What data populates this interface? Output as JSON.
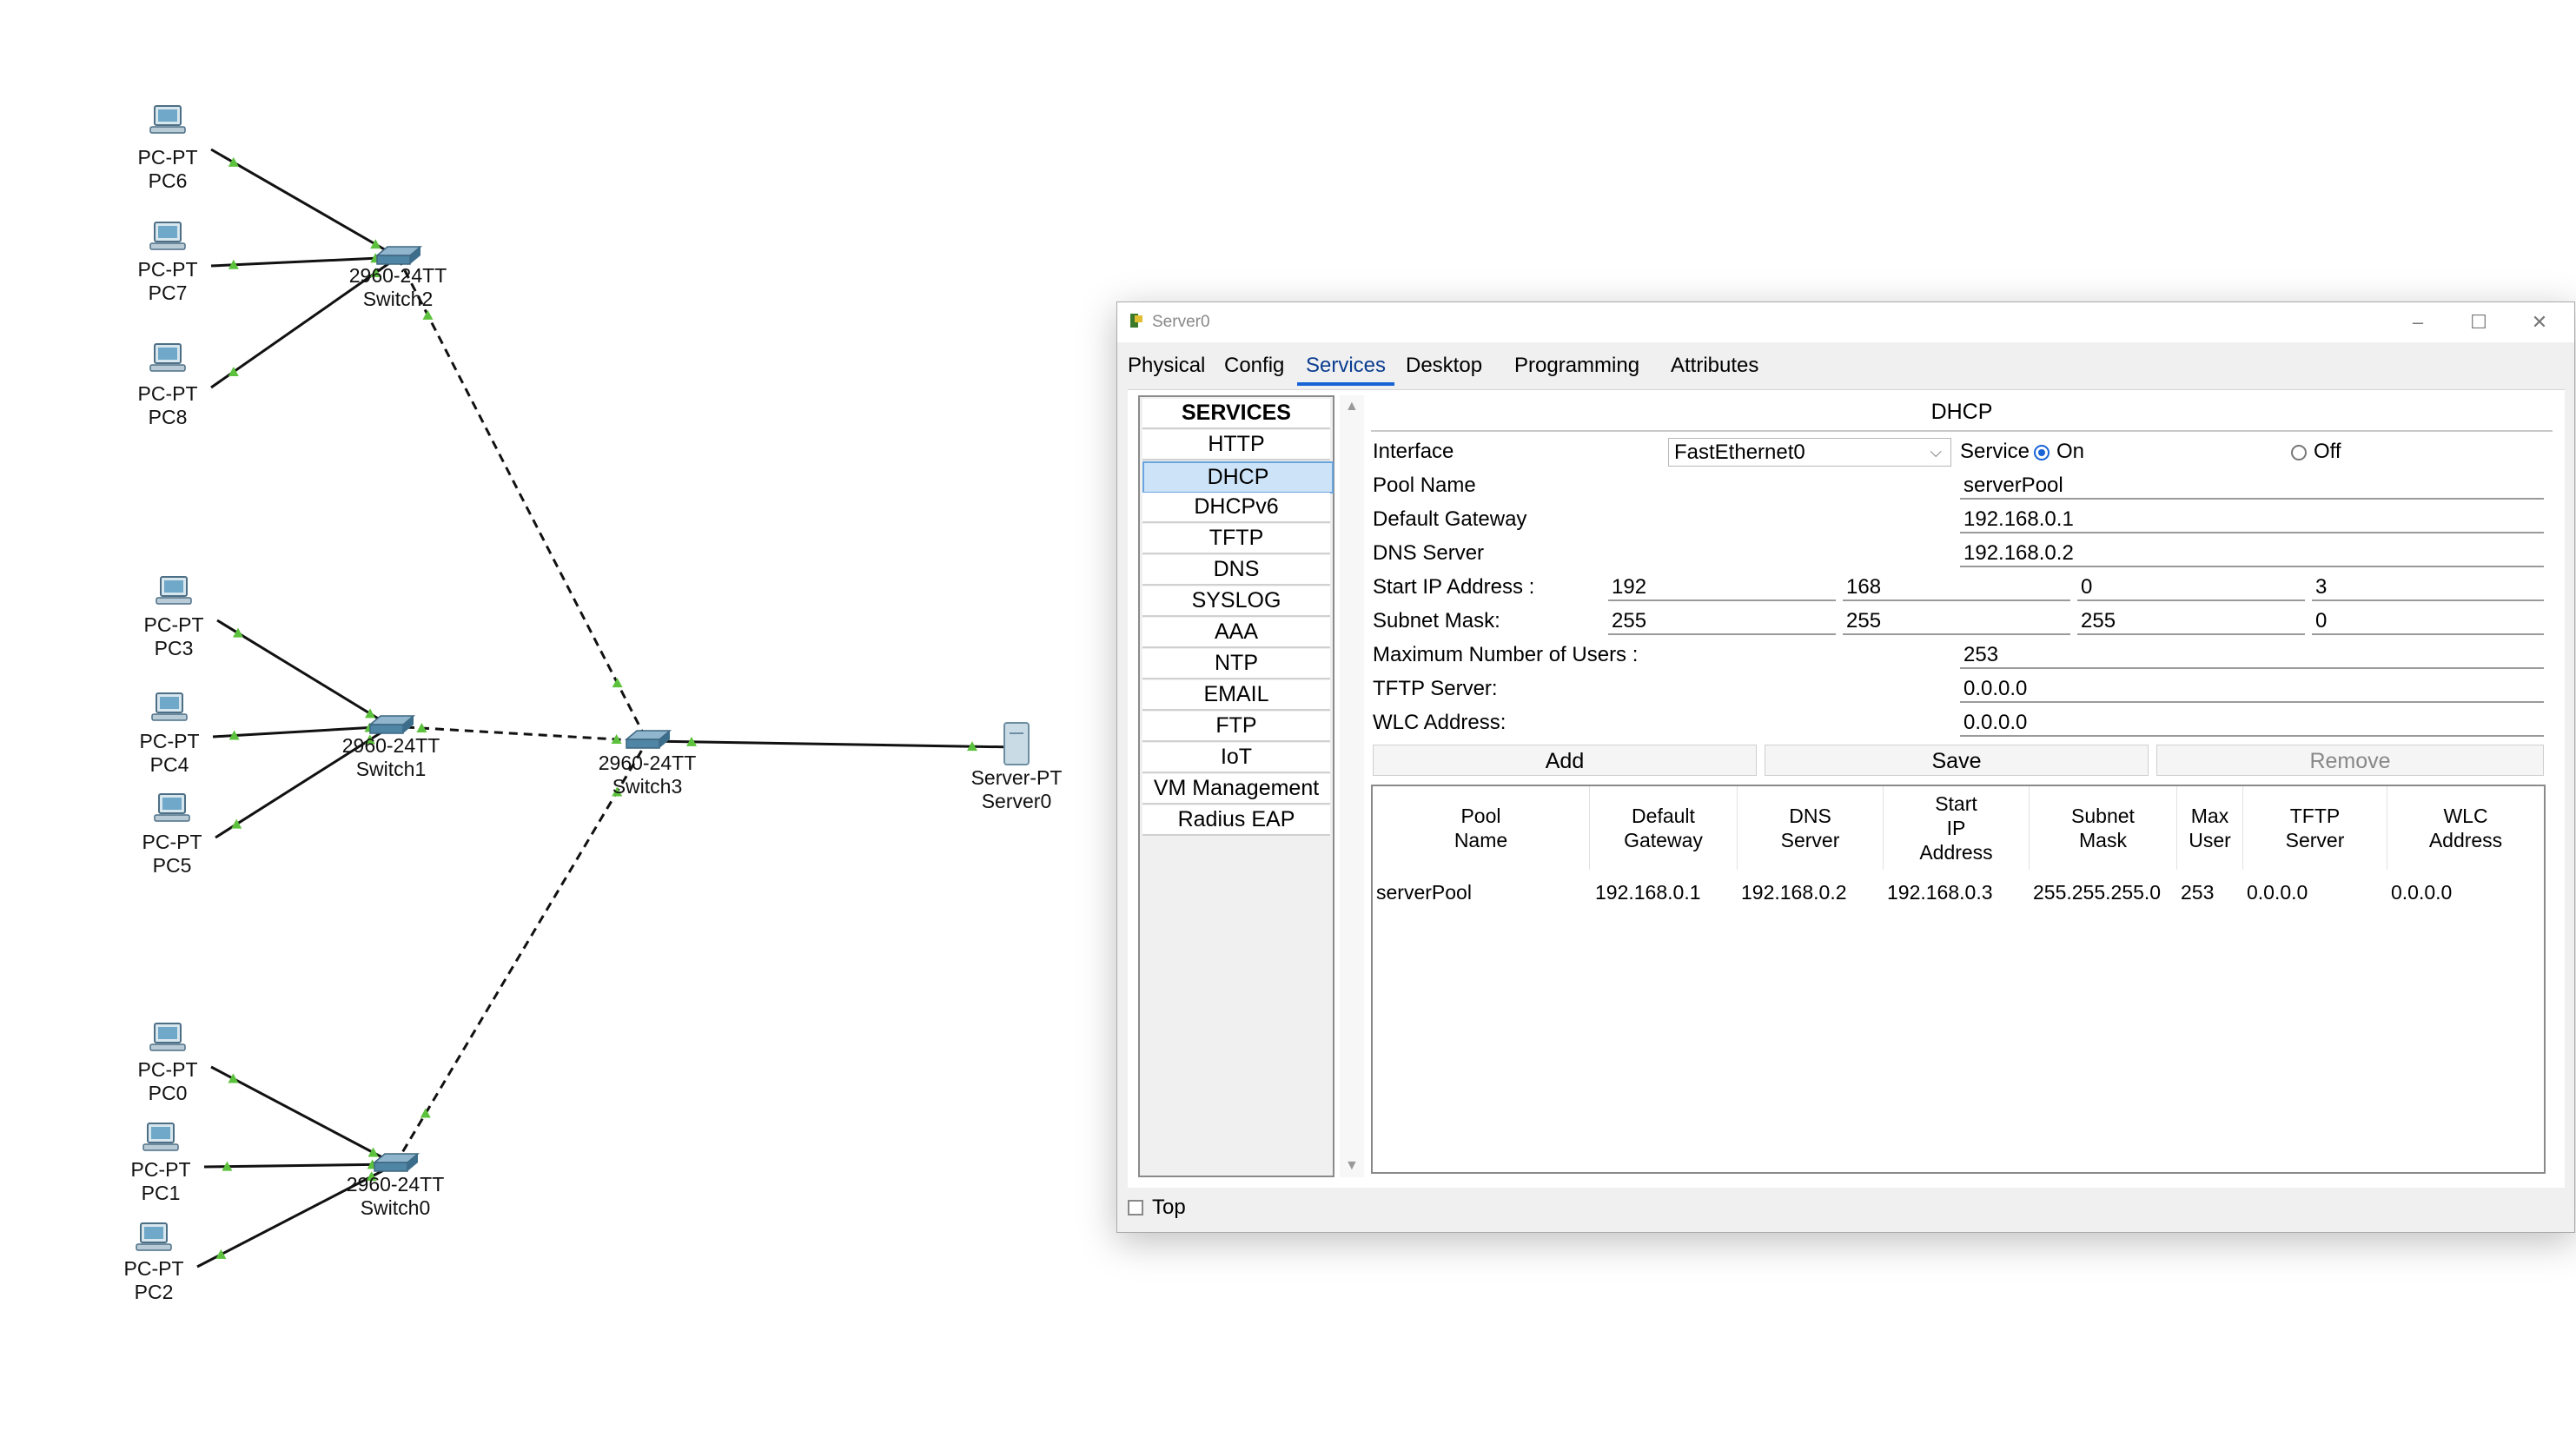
{
  "topology": {
    "devices": [
      {
        "id": "pc6",
        "model": "PC-PT",
        "name": "PC6"
      },
      {
        "id": "pc7",
        "model": "PC-PT",
        "name": "PC7"
      },
      {
        "id": "pc8",
        "model": "PC-PT",
        "name": "PC8"
      },
      {
        "id": "pc3",
        "model": "PC-PT",
        "name": "PC3"
      },
      {
        "id": "pc4",
        "model": "PC-PT",
        "name": "PC4"
      },
      {
        "id": "pc5",
        "model": "PC-PT",
        "name": "PC5"
      },
      {
        "id": "pc0",
        "model": "PC-PT",
        "name": "PC0"
      },
      {
        "id": "pc1",
        "model": "PC-PT",
        "name": "PC1"
      },
      {
        "id": "pc2",
        "model": "PC-PT",
        "name": "PC2"
      },
      {
        "id": "switch2",
        "model": "2960-24TT",
        "name": "Switch2"
      },
      {
        "id": "switch1",
        "model": "2960-24TT",
        "name": "Switch1"
      },
      {
        "id": "switch0",
        "model": "2960-24TT",
        "name": "Switch0"
      },
      {
        "id": "switch3",
        "model": "2960-24TT",
        "name": "Switch3"
      },
      {
        "id": "server0",
        "model": "Server-PT",
        "name": "Server0"
      }
    ],
    "links": [
      {
        "from": "pc6",
        "to": "switch2",
        "type": "straight"
      },
      {
        "from": "pc7",
        "to": "switch2",
        "type": "straight"
      },
      {
        "from": "pc8",
        "to": "switch2",
        "type": "straight"
      },
      {
        "from": "pc3",
        "to": "switch1",
        "type": "straight"
      },
      {
        "from": "pc4",
        "to": "switch1",
        "type": "straight"
      },
      {
        "from": "pc5",
        "to": "switch1",
        "type": "straight"
      },
      {
        "from": "pc0",
        "to": "switch0",
        "type": "straight"
      },
      {
        "from": "pc1",
        "to": "switch0",
        "type": "straight"
      },
      {
        "from": "pc2",
        "to": "switch0",
        "type": "straight"
      },
      {
        "from": "switch2",
        "to": "switch3",
        "type": "crossover"
      },
      {
        "from": "switch1",
        "to": "switch3",
        "type": "crossover"
      },
      {
        "from": "switch0",
        "to": "switch3",
        "type": "crossover"
      },
      {
        "from": "switch3",
        "to": "server0",
        "type": "straight"
      }
    ],
    "link_color": "#111111",
    "port_up_color": "#5cc13c"
  },
  "window": {
    "title": "Server0",
    "controls": {
      "minimize": "–",
      "maximize": "☐",
      "close": "✕"
    },
    "tabs": [
      "Physical",
      "Config",
      "Services",
      "Desktop",
      "Programming",
      "Attributes"
    ],
    "active_tab": "Services",
    "services": {
      "header": "SERVICES",
      "items": [
        "HTTP",
        "DHCP",
        "DHCPv6",
        "TFTP",
        "DNS",
        "SYSLOG",
        "AAA",
        "NTP",
        "EMAIL",
        "FTP",
        "IoT",
        "VM Management",
        "Radius EAP"
      ],
      "selected": "DHCP"
    },
    "dhcp": {
      "title": "DHCP",
      "interface_label": "Interface",
      "interface_value": "FastEthernet0",
      "service_label": "Service",
      "on_label": "On",
      "off_label": "Off",
      "service_state": "On",
      "pool_name_label": "Pool Name",
      "pool_name": "serverPool",
      "gateway_label": "Default Gateway",
      "gateway": "192.168.0.1",
      "dns_label": "DNS Server",
      "dns": "192.168.0.2",
      "start_ip_label": "Start IP Address :",
      "start_ip": [
        "192",
        "168",
        "0",
        "3"
      ],
      "mask_label": "Subnet Mask:",
      "mask": [
        "255",
        "255",
        "255",
        "0"
      ],
      "max_users_label": "Maximum Number of Users :",
      "max_users": "253",
      "tftp_label": "TFTP Server:",
      "tftp": "0.0.0.0",
      "wlc_label": "WLC Address:",
      "wlc": "0.0.0.0",
      "buttons": {
        "add": "Add",
        "save": "Save",
        "remove": "Remove"
      },
      "table": {
        "columns": [
          "Pool\nName",
          "Default\nGateway",
          "DNS\nServer",
          "Start\nIP\nAddress",
          "Subnet\nMask",
          "Max\nUser",
          "TFTP\nServer",
          "WLC\nAddress"
        ],
        "rows": [
          [
            "serverPool",
            "192.168.0.1",
            "192.168.0.2",
            "192.168.0.3",
            "255.255.255.0",
            "253",
            "0.0.0.0",
            "0.0.0.0"
          ]
        ]
      }
    },
    "top_checkbox_label": "Top",
    "top_checked": false
  }
}
